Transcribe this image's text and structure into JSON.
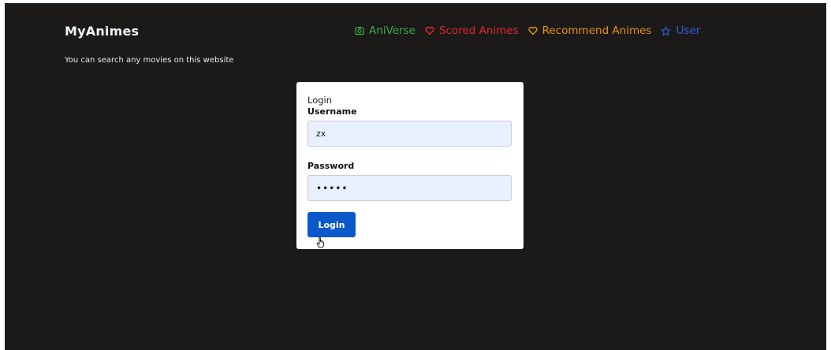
{
  "header": {
    "brand": "MyAnimes",
    "tagline": "You can search any movies on this website"
  },
  "nav": {
    "items": [
      {
        "label": "AniVerse",
        "icon": "camera-icon",
        "color": "#3cab4e"
      },
      {
        "label": "Scored Animes",
        "icon": "heart-icon",
        "color": "#e0262c"
      },
      {
        "label": "Recommend Animes",
        "icon": "heart-icon",
        "color": "#e4900e"
      },
      {
        "label": "User",
        "icon": "star-icon",
        "color": "#2f5ce6"
      }
    ]
  },
  "login": {
    "title": "Login",
    "username_label": "Username",
    "username_value": "zx",
    "password_label": "Password",
    "password_value": "•••••",
    "button_label": "Login",
    "button_color": "#0a58c9"
  }
}
